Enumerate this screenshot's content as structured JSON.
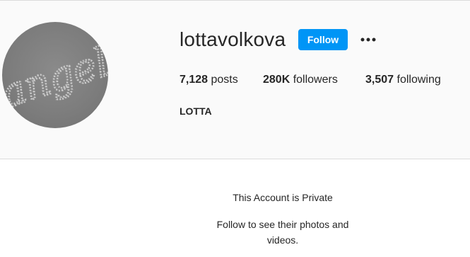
{
  "profile": {
    "username": "lottavolkova",
    "follow_label": "Follow",
    "more_icon": "more-options-icon",
    "avatar_text": "angel",
    "full_name": "LOTTA",
    "stats": {
      "posts_count": "7,128",
      "posts_label": " posts",
      "followers_count": "280K",
      "followers_label": " followers",
      "following_count": "3,507",
      "following_label": " following"
    }
  },
  "private_notice": {
    "title": "This Account is Private",
    "subtitle": "Follow to see their photos and videos."
  },
  "colors": {
    "accent": "#0095f6",
    "header_background": "#fafafa",
    "text": "#262626"
  }
}
